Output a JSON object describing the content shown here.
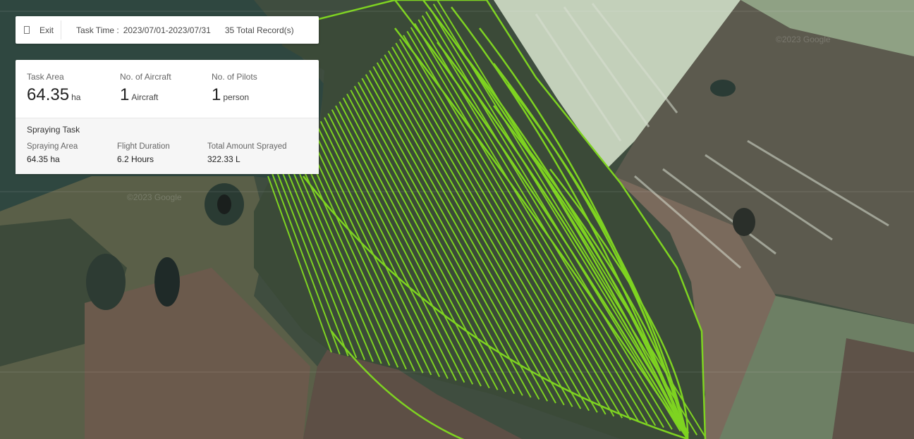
{
  "toolbar": {
    "exit_label": "Exit",
    "task_time_label": "Task Time :",
    "task_time_value": "2023/07/01-2023/07/31",
    "records_label": "35 Total Record(s)"
  },
  "summary": {
    "task_area": {
      "label": "Task Area",
      "value": "64.35",
      "unit": "ha"
    },
    "aircraft": {
      "label": "No. of Aircraft",
      "value": "1",
      "unit": "Aircraft"
    },
    "pilots": {
      "label": "No. of Pilots",
      "value": "1",
      "unit": "person"
    }
  },
  "spraying": {
    "title": "Spraying Task",
    "area": {
      "label": "Spraying Area",
      "value": "64.35 ha"
    },
    "duration": {
      "label": "Flight Duration",
      "value": "6.2 Hours"
    },
    "amount": {
      "label": "Total Amount Sprayed",
      "value": "322.33 L"
    }
  },
  "map": {
    "flight_path_color": "#7ed321",
    "field_colors": [
      "#3c4b3a",
      "#4b5a45",
      "#6b5a4c",
      "#cfd8c2",
      "#7c8c6c"
    ],
    "watermark": "©2023 Google"
  }
}
